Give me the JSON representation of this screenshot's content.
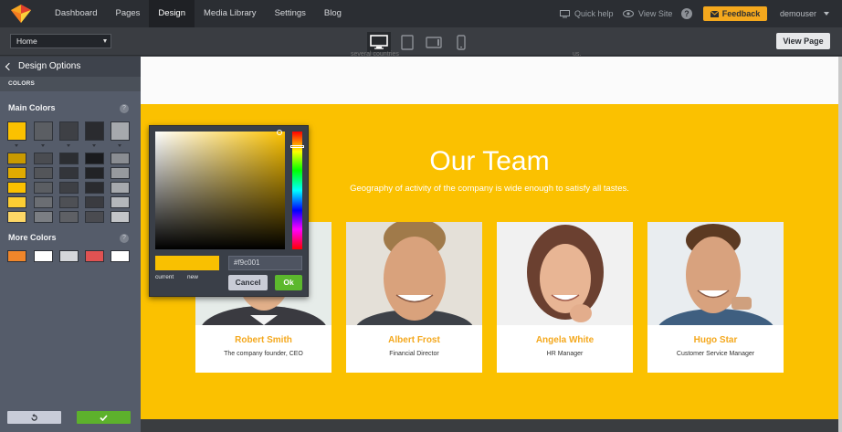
{
  "nav": {
    "items": [
      {
        "label": "Dashboard",
        "active": false
      },
      {
        "label": "Pages",
        "active": false
      },
      {
        "label": "Design",
        "active": true
      },
      {
        "label": "Media Library",
        "active": false
      },
      {
        "label": "Settings",
        "active": false
      },
      {
        "label": "Blog",
        "active": false
      }
    ],
    "quick_help": "Quick help",
    "view_site": "View Site",
    "help_icon": "?",
    "feedback": "Feedback",
    "user": "demouser"
  },
  "toolbar": {
    "page_select": "Home",
    "devices": [
      {
        "name": "desktop-view-icon",
        "active": true
      },
      {
        "name": "tablet-view-icon",
        "active": false
      },
      {
        "name": "tablet-landscape-view-icon",
        "active": false
      },
      {
        "name": "mobile-view-icon",
        "active": false
      }
    ],
    "view_page": "View Page"
  },
  "sidebar": {
    "title": "Design Options",
    "section": "COLORS",
    "main_colors_label": "Main Colors",
    "more_colors_label": "More Colors",
    "help": "?",
    "main_top": [
      "#fbc100",
      "#5b5e63",
      "#3e4045",
      "#2a2b2f",
      "#a6a9ad"
    ],
    "main_shades": [
      [
        "#c99a00",
        "#4a4c51",
        "#2c2e32",
        "#1a1b1e",
        "#8a8d92"
      ],
      [
        "#e0ab00",
        "#535559",
        "#33353a",
        "#222326",
        "#979a9e"
      ],
      [
        "#fbc100",
        "#5b5e63",
        "#3e4045",
        "#2a2b2f",
        "#a6a9ad"
      ],
      [
        "#fccd33",
        "#6b6e73",
        "#4e5055",
        "#3a3b40",
        "#b4b7bb"
      ],
      [
        "#fdd766",
        "#7b7e83",
        "#5e6065",
        "#4a4b50",
        "#c3c5c8"
      ]
    ],
    "more_colors": [
      "#f0862a",
      "#ffffff",
      "#d4d6da",
      "#e05252",
      "#ffffff"
    ]
  },
  "picker": {
    "hex_value": "#f9c001",
    "current_label": "current",
    "new_label": "new",
    "cancel": "Cancel",
    "ok": "Ok"
  },
  "page": {
    "strip_left": "several countries",
    "strip_right": "us.",
    "team_title": "Our Team",
    "team_subtitle": "Geography of activity of the company is wide enough to satisfy all tastes.",
    "members": [
      {
        "name": "Robert Smith",
        "role": "The company founder, CEO"
      },
      {
        "name": "Albert Frost",
        "role": "Financial Director"
      },
      {
        "name": "Angela White",
        "role": "HR Manager"
      },
      {
        "name": "Hugo Star",
        "role": "Customer Service Manager"
      }
    ]
  }
}
